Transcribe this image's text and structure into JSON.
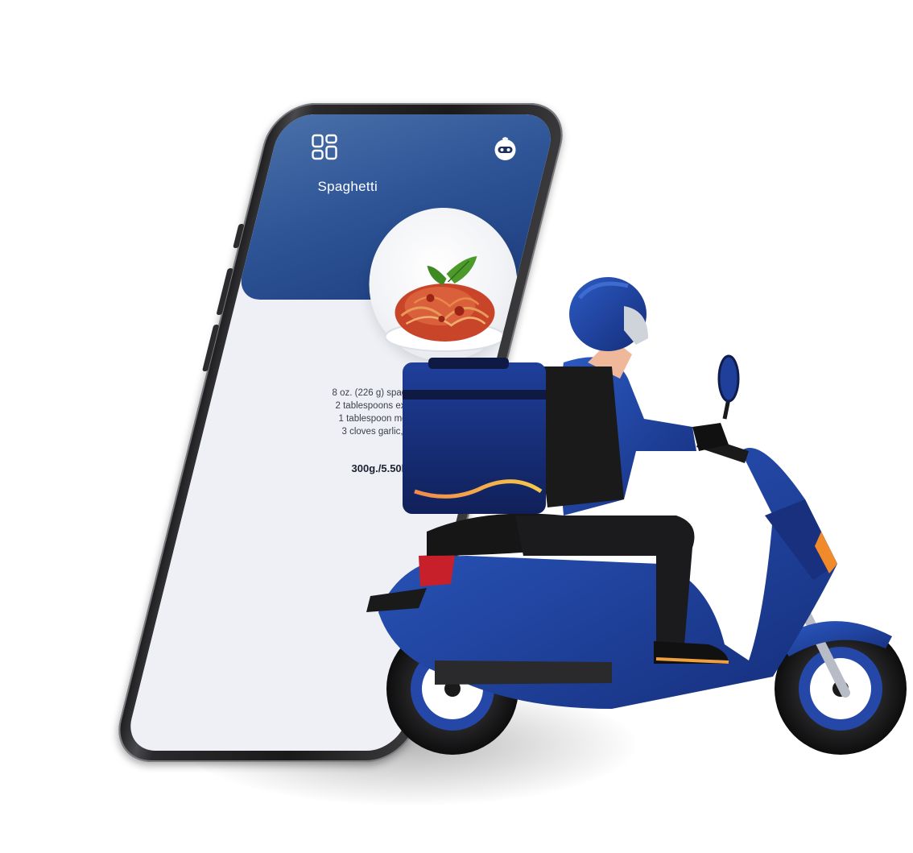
{
  "screen": {
    "title": "Spaghetti",
    "ingredients": [
      "8 oz. (226 g) spaghetti",
      "2 tablespoons extra virgin",
      "1 tablespoon melted bu",
      "3 cloves garlic, minced"
    ],
    "nutrition": "300g./5.50kcal"
  },
  "icons": {
    "menu": "grid-menu-icon",
    "profile": "robot-avatar-icon"
  },
  "colors": {
    "header_top": "#4a6fa8",
    "header_bottom": "#1d3c7e",
    "rider_blue": "#1f3f9a",
    "accent_orange": "#f4a640"
  }
}
